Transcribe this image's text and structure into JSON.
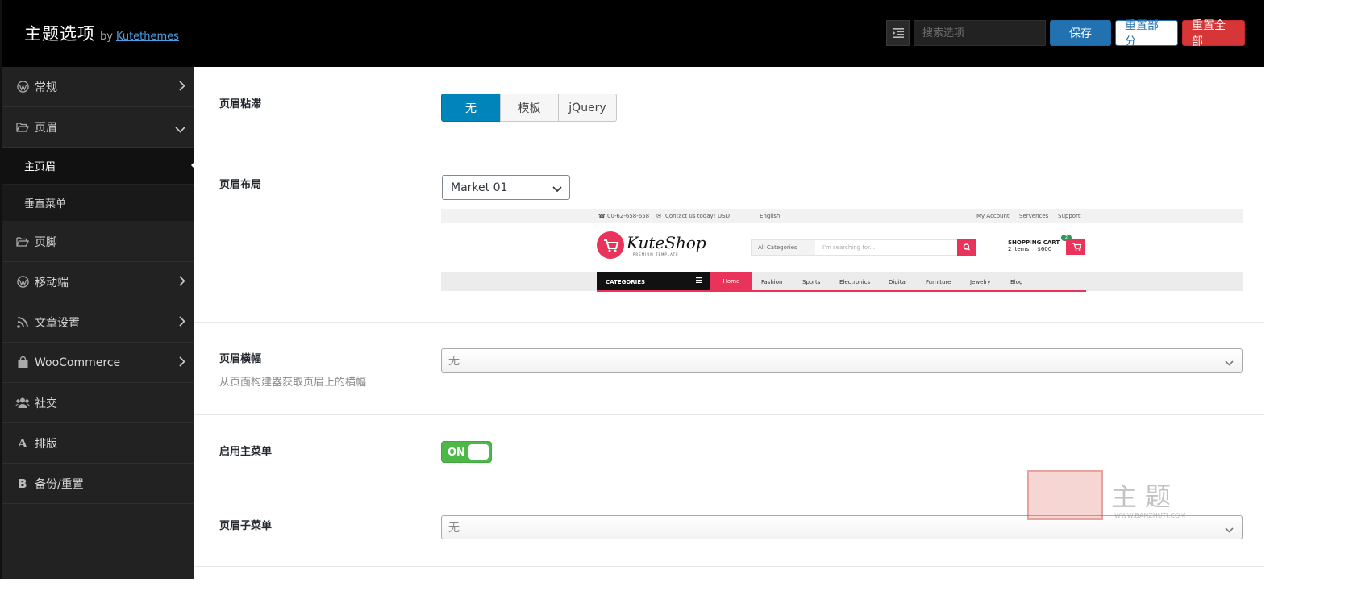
{
  "header": {
    "title": "主题选项",
    "by": "by",
    "author": "Kutethemes",
    "search_placeholder": "搜索选项",
    "save": "保存",
    "reset_section": "重置部分",
    "reset_all": "重置全部"
  },
  "sidebar": {
    "items": [
      {
        "label": "常规",
        "icon": "wordpress-icon"
      },
      {
        "label": "页眉",
        "icon": "folder-open-icon"
      },
      {
        "label": "主页眉",
        "sub": true,
        "active": true
      },
      {
        "label": "垂直菜单",
        "sub": true
      },
      {
        "label": "页脚",
        "icon": "folder-open-icon"
      },
      {
        "label": "移动端",
        "icon": "wordpress-icon"
      },
      {
        "label": "文章设置",
        "icon": "rss-icon"
      },
      {
        "label": "WooCommerce",
        "icon": "shopping-bag-icon"
      },
      {
        "label": "社交",
        "icon": "users-icon"
      },
      {
        "label": "排版",
        "icon": "font-icon"
      },
      {
        "label": "备份/重置",
        "icon": "bold-icon"
      }
    ]
  },
  "fields": {
    "sticky": {
      "label": "页眉粘滞",
      "options": [
        "无",
        "模板",
        "jQuery"
      ],
      "selected": "无"
    },
    "layout": {
      "label": "页眉布局",
      "value": "Market 01"
    },
    "banner": {
      "label": "页眉横幅",
      "description": "从页面构建器获取页眉上的横幅",
      "value": "无"
    },
    "main_menu": {
      "label": "启用主菜单",
      "state": "ON"
    },
    "sub_menu": {
      "label": "页眉子菜单",
      "value": "无"
    }
  },
  "preview": {
    "phone": "00-62-658-658",
    "contact": "Contact us today!",
    "currency": "USD",
    "language": "English",
    "my_account": "My Account",
    "services": "Servences",
    "support": "Support",
    "logo": "KuteShop",
    "logo_sub": "PREMIUM TEMPLATE",
    "all_categories": "All Categories",
    "search_placeholder": "I'm searching for...",
    "cart_title": "SHOPPING CART",
    "cart_items": "2 items",
    "cart_total": "$600",
    "cart_badge": "2",
    "categories": "CATEGORIES",
    "menu": [
      "Home",
      "Fashion",
      "Sports",
      "Electronics",
      "Digital",
      "Furniture",
      "Jewelry",
      "Blog"
    ]
  },
  "watermark": {
    "text": "主题",
    "url": "WWW.BANZHUTI.COM"
  },
  "colors": {
    "primary": "#2271b1",
    "danger": "#d63638",
    "selected_option": "#0085ba",
    "switch_on": "#4cb848",
    "brand_pink": "#e9335a"
  }
}
